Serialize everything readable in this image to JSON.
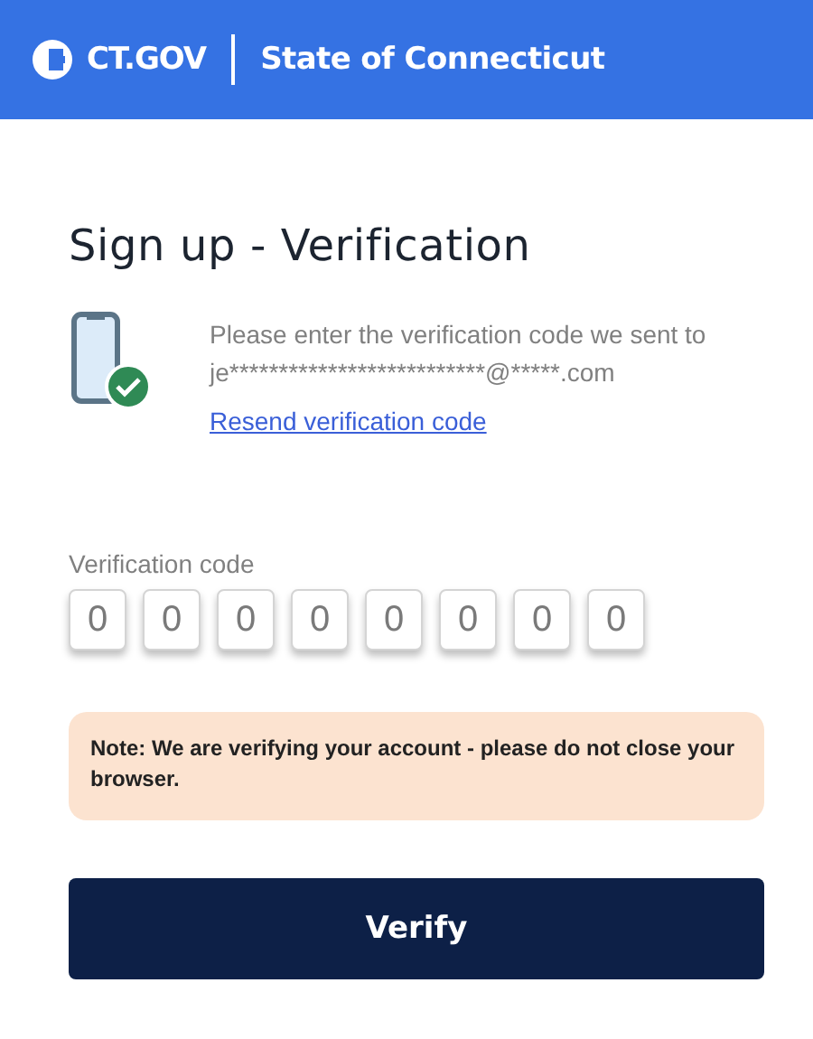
{
  "header": {
    "logo_text": "CT.GOV",
    "title": "State of Connecticut"
  },
  "page_title": "Sign up - Verification",
  "instructions": {
    "text": "Please enter the verification code we sent to",
    "email": "je**************************@*****.com",
    "resend_link": "Resend verification code"
  },
  "code_field": {
    "label": "Verification code",
    "digits": [
      {
        "placeholder": "0"
      },
      {
        "placeholder": "0"
      },
      {
        "placeholder": "0"
      },
      {
        "placeholder": "0"
      },
      {
        "placeholder": "0"
      },
      {
        "placeholder": "0"
      },
      {
        "placeholder": "0"
      },
      {
        "placeholder": "0"
      }
    ]
  },
  "note": "Note: We are verifying your account - please do not close your browser.",
  "buttons": [
    {
      "label": "Verify"
    }
  ]
}
